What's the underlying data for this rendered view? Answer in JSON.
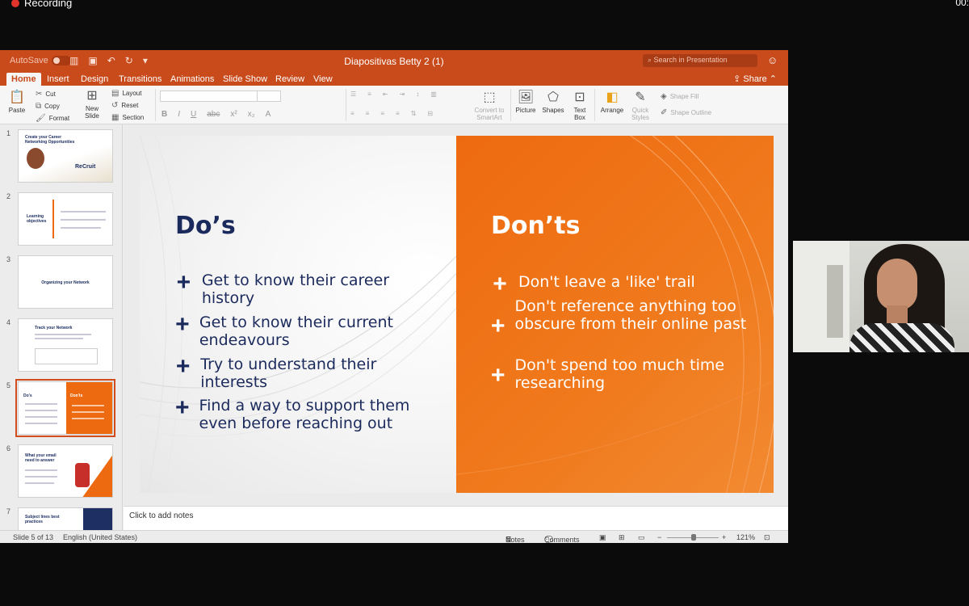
{
  "screen": {
    "recording_label": "Recording",
    "clock_text": "00:"
  },
  "app": {
    "autosave_label": "AutoSave",
    "autosave_state": "OFF",
    "document_title": "Diapositivas Betty 2 (1)",
    "search_placeholder": "Search in Presentation",
    "share_label": "Share",
    "accent_color": "#c94a1b",
    "tabs": [
      "Home",
      "Insert",
      "Design",
      "Transitions",
      "Animations",
      "Slide Show",
      "Review",
      "View"
    ],
    "active_tab": "Home"
  },
  "ribbon": {
    "paste": "Paste",
    "cut": "Cut",
    "copy": "Copy",
    "format": "Format",
    "new_slide": "New Slide",
    "layout": "Layout",
    "reset": "Reset",
    "section": "Section",
    "convert_smartart": "Convert to SmartArt",
    "picture": "Picture",
    "shapes": "Shapes",
    "text_box": "Text Box",
    "arrange": "Arrange",
    "quick_styles": "Quick Styles",
    "shape_fill": "Shape Fill",
    "shape_outline": "Shape Outline"
  },
  "thumbnails": [
    {
      "number": "1",
      "title": "Create your Career Networking Opportunities",
      "brand": "ReCruit"
    },
    {
      "number": "2",
      "title": "Learning objectives"
    },
    {
      "number": "3",
      "title": "Organizing your Network"
    },
    {
      "number": "4",
      "title": "Track your Network"
    },
    {
      "number": "5",
      "title": "Do's",
      "title2": "Don'ts"
    },
    {
      "number": "6",
      "title": "What your email need to answer"
    },
    {
      "number": "7",
      "title": "Subject lines best practices"
    }
  ],
  "slide": {
    "dos_heading": "Do’s",
    "donts_heading": "Don’ts",
    "dos": [
      "Get to know their career history",
      "Get to know their current endeavours",
      "Try to understand their interests",
      "Find a way to support them even before reaching out"
    ],
    "donts": [
      "Don't leave a 'like' trail",
      "Don't reference anything too obscure from their online past",
      "Don't spend too much time researching"
    ],
    "navy_color": "#1b2a5c",
    "orange_color": "#ee6a10"
  },
  "notes_placeholder": "Click to add notes",
  "status": {
    "slide_counter": "Slide 5 of 13",
    "language": "English (United States)",
    "notes_label": "Notes",
    "comments_label": "Comments",
    "zoom": "121%"
  }
}
